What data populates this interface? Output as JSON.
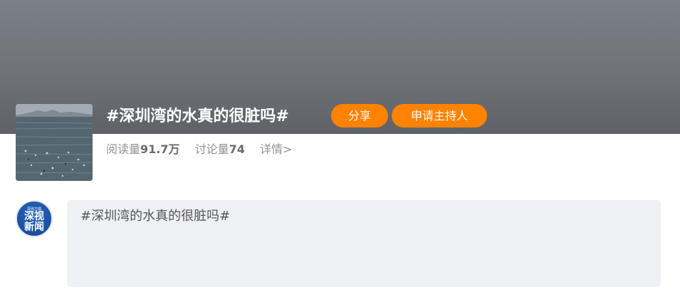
{
  "topic": {
    "title": "#深圳湾的水真的很脏吗#",
    "share_label": "分享",
    "apply_host_label": "申请主持人",
    "stats": {
      "read_label": "阅读量",
      "read_value": "91.7万",
      "discuss_label": "讨论量",
      "discuss_value": "74",
      "detail_label": "详情>"
    }
  },
  "post": {
    "avatar_small": "深圳卫视",
    "avatar_line1": "深视",
    "avatar_line2": "新闻",
    "text": "#深圳湾的水真的很脏吗#"
  },
  "colors": {
    "accent": "#ff8200",
    "banner": "#73777c",
    "post_background": "#eff0f4"
  },
  "icons": [
    "topic-cover-image",
    "account-avatar"
  ]
}
